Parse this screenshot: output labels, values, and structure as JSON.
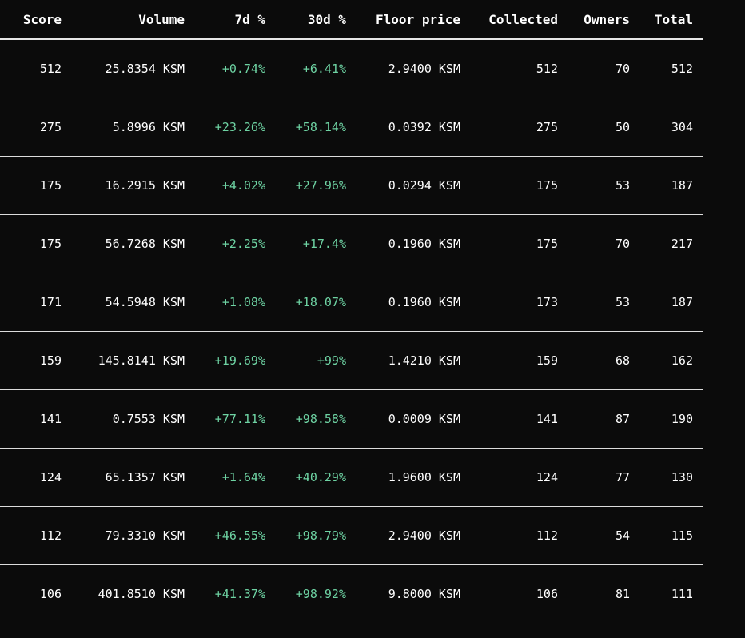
{
  "columns": [
    "Score",
    "Volume",
    "7d %",
    "30d %",
    "Floor price",
    "Collected",
    "Owners",
    "Total"
  ],
  "rows": [
    {
      "score": "512",
      "volume": "25.8354 KSM",
      "d7": "+0.74%",
      "d30": "+6.41%",
      "floor": "2.9400 KSM",
      "collected": "512",
      "owners": "70",
      "total": "512"
    },
    {
      "score": "275",
      "volume": "5.8996 KSM",
      "d7": "+23.26%",
      "d30": "+58.14%",
      "floor": "0.0392 KSM",
      "collected": "275",
      "owners": "50",
      "total": "304"
    },
    {
      "score": "175",
      "volume": "16.2915 KSM",
      "d7": "+4.02%",
      "d30": "+27.96%",
      "floor": "0.0294 KSM",
      "collected": "175",
      "owners": "53",
      "total": "187"
    },
    {
      "score": "175",
      "volume": "56.7268 KSM",
      "d7": "+2.25%",
      "d30": "+17.4%",
      "floor": "0.1960 KSM",
      "collected": "175",
      "owners": "70",
      "total": "217"
    },
    {
      "score": "171",
      "volume": "54.5948 KSM",
      "d7": "+1.08%",
      "d30": "+18.07%",
      "floor": "0.1960 KSM",
      "collected": "173",
      "owners": "53",
      "total": "187"
    },
    {
      "score": "159",
      "volume": "145.8141 KSM",
      "d7": "+19.69%",
      "d30": "+99%",
      "floor": "1.4210 KSM",
      "collected": "159",
      "owners": "68",
      "total": "162"
    },
    {
      "score": "141",
      "volume": "0.7553 KSM",
      "d7": "+77.11%",
      "d30": "+98.58%",
      "floor": "0.0009 KSM",
      "collected": "141",
      "owners": "87",
      "total": "190"
    },
    {
      "score": "124",
      "volume": "65.1357 KSM",
      "d7": "+1.64%",
      "d30": "+40.29%",
      "floor": "1.9600 KSM",
      "collected": "124",
      "owners": "77",
      "total": "130"
    },
    {
      "score": "112",
      "volume": "79.3310 KSM",
      "d7": "+46.55%",
      "d30": "+98.79%",
      "floor": "2.9400 KSM",
      "collected": "112",
      "owners": "54",
      "total": "115"
    },
    {
      "score": "106",
      "volume": "401.8510 KSM",
      "d7": "+41.37%",
      "d30": "+98.92%",
      "floor": "9.8000 KSM",
      "collected": "106",
      "owners": "81",
      "total": "111"
    }
  ],
  "colors": {
    "background": "#0b0b0b",
    "text": "#ffffff",
    "positive_change": "#6ed3a3",
    "divider": "#dcdcdc"
  }
}
